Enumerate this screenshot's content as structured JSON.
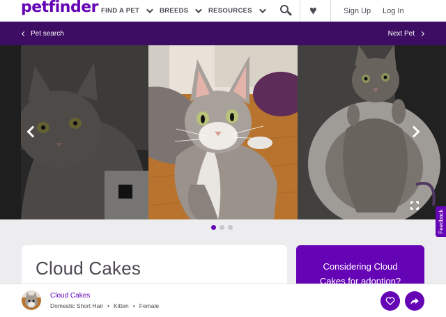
{
  "brand": {
    "logo_text": "petfinder",
    "accent_color": "#6504b5",
    "dark_bar_color": "#3c0d63"
  },
  "nav": {
    "items": [
      {
        "label": "FIND A PET"
      },
      {
        "label": "BREEDS"
      },
      {
        "label": "RESOURCES"
      }
    ],
    "search_icon": "search-icon",
    "favorites_icon": "heart-icon",
    "sign_up": "Sign Up",
    "log_in": "Log In"
  },
  "subnav": {
    "back_label": "Pet search",
    "next_label": "Next Pet"
  },
  "carousel": {
    "photos": [
      "tabby kitten sitting in shadow",
      "tabby kitten lying on wood floor",
      "tabby kitten sitting in cat bed"
    ],
    "dot_count": 3,
    "active_dot": 1
  },
  "feedback_label": "Feedback",
  "pet": {
    "name": "Cloud Cakes",
    "breed": "Domestic Short Hair",
    "age": "Kitten",
    "gender": "Female"
  },
  "adopt_cta": "Considering Cloud Cakes for adoption?"
}
